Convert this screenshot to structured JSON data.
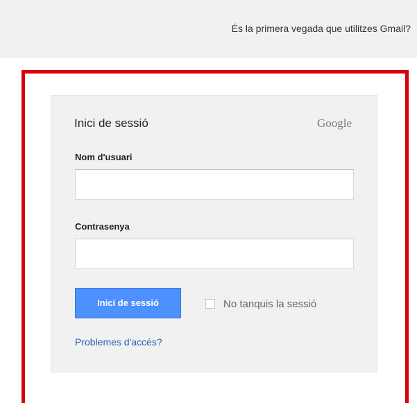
{
  "header": {
    "first_time_link": "És la primera vegada que utilitzes Gmail?"
  },
  "signin": {
    "title": "Inici de sessió",
    "logo_text": "Google",
    "username_label": "Nom d'usuari",
    "username_value": "",
    "password_label": "Contrasenya",
    "password_value": "",
    "signin_button": "Inici de sessió",
    "stay_signed_in_label": "No tanquis la sessió",
    "stay_signed_in_checked": false,
    "trouble_link": "Problemes d'accés?"
  },
  "colors": {
    "highlight_frame": "#d8000a",
    "button_blue": "#4d90fe",
    "link_blue": "#2a5db0",
    "box_background": "#f1f1f1"
  }
}
